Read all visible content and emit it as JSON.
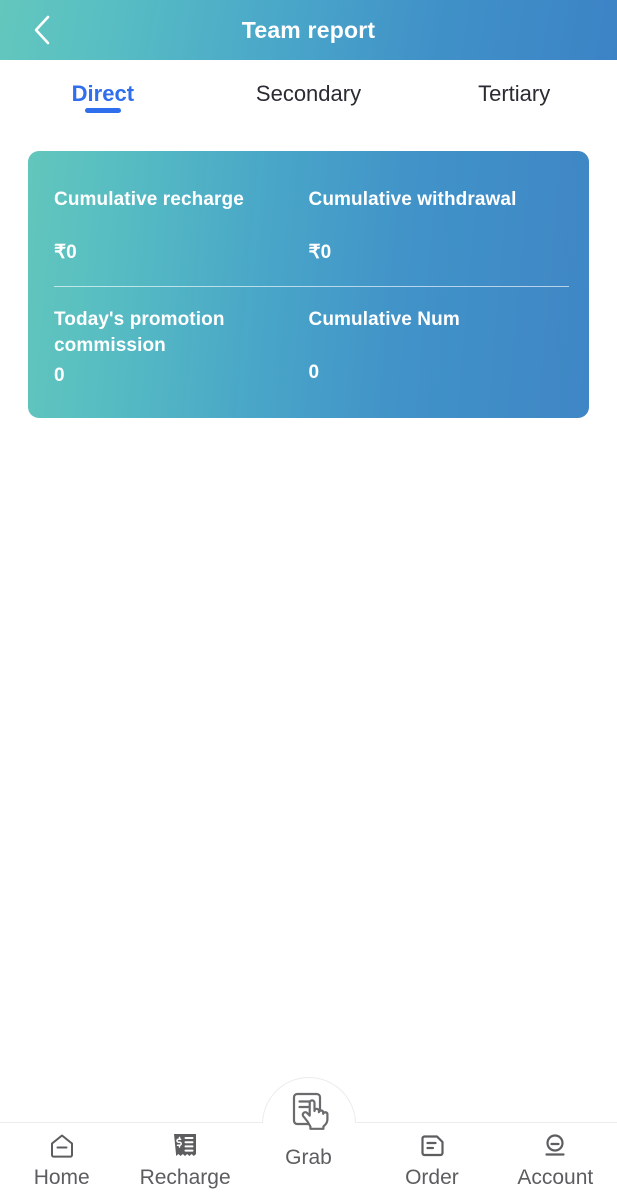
{
  "header": {
    "title": "Team report",
    "back_icon": "chevron-left-icon",
    "gradient_from": "#63c7bd",
    "gradient_to": "#3c83c6"
  },
  "tabs": {
    "active_index": 0,
    "items": [
      {
        "label": "Direct"
      },
      {
        "label": "Secondary"
      },
      {
        "label": "Tertiary"
      }
    ],
    "active_color": "#2f6fed",
    "inactive_color": "#2b2b33"
  },
  "summary_card": {
    "gradient_from": "#62c6bc",
    "gradient_to": "#3f86c6",
    "rows": [
      {
        "cells": [
          {
            "label": "Cumulative recharge",
            "value": "₹0"
          },
          {
            "label": "Cumulative withdrawal",
            "value": "₹0"
          }
        ]
      },
      {
        "cells": [
          {
            "label": "Today's promotion commission",
            "value": "0"
          },
          {
            "label": "Cumulative Num",
            "value": "0"
          }
        ]
      }
    ]
  },
  "bottom_nav": {
    "label_color": "#5d5d60",
    "items": [
      {
        "label": "Home",
        "icon": "home-icon"
      },
      {
        "label": "Recharge",
        "icon": "receipt-dollar-icon"
      },
      {
        "label": "Grab",
        "icon": "document-hand-tap-icon"
      },
      {
        "label": "Order",
        "icon": "document-lines-icon"
      },
      {
        "label": "Account",
        "icon": "user-person-icon"
      }
    ]
  }
}
